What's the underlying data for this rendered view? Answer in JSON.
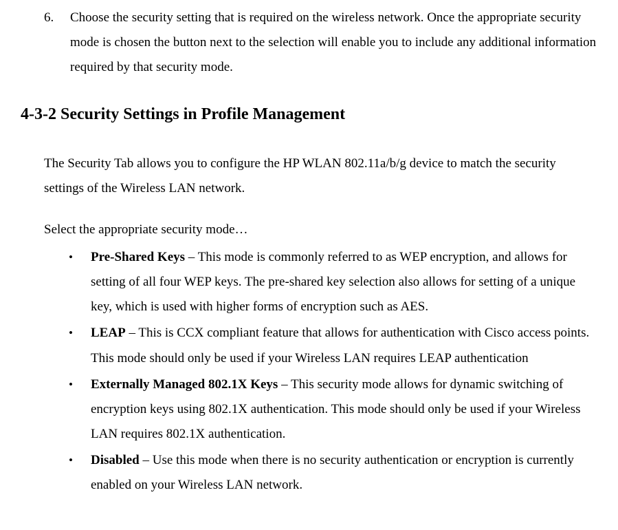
{
  "step6": {
    "num": "6.",
    "text": "Choose the security setting that is required on the wireless network.  Once the appropriate security mode is chosen the button next to the selection will enable you to include any additional information required by that security mode."
  },
  "heading": "4-3-2 Security Settings in Profile Management",
  "intro": "The Security Tab allows you to configure the HP WLAN 802.11a/b/g  device to match the security settings of the Wireless LAN network.",
  "select_line": "Select the appropriate security mode…",
  "bullets": {
    "dot": "•",
    "b0": {
      "bold": "Pre-Shared Keys",
      "rest": " – This mode is commonly referred to as WEP encryption, and allows for setting of all four WEP keys.  The pre-shared key selection also allows for setting of a unique key, which is used with higher forms of encryption such as AES."
    },
    "b1": {
      "bold": "LEAP",
      "rest": " – This is CCX compliant feature that allows for authentication with Cisco access points.  This mode should only be used if your Wireless LAN requires LEAP authentication"
    },
    "b2": {
      "bold": "Externally Managed 802.1X Keys",
      "rest": " – This security mode allows for dynamic switching of encryption keys using 802.1X authentication.  This mode should only be used if your Wireless LAN requires 802.1X authentication."
    },
    "b3": {
      "bold": "Disabled",
      "rest": " – Use this mode when there is no security authentication or encryption is currently enabled on your Wireless LAN network."
    }
  }
}
